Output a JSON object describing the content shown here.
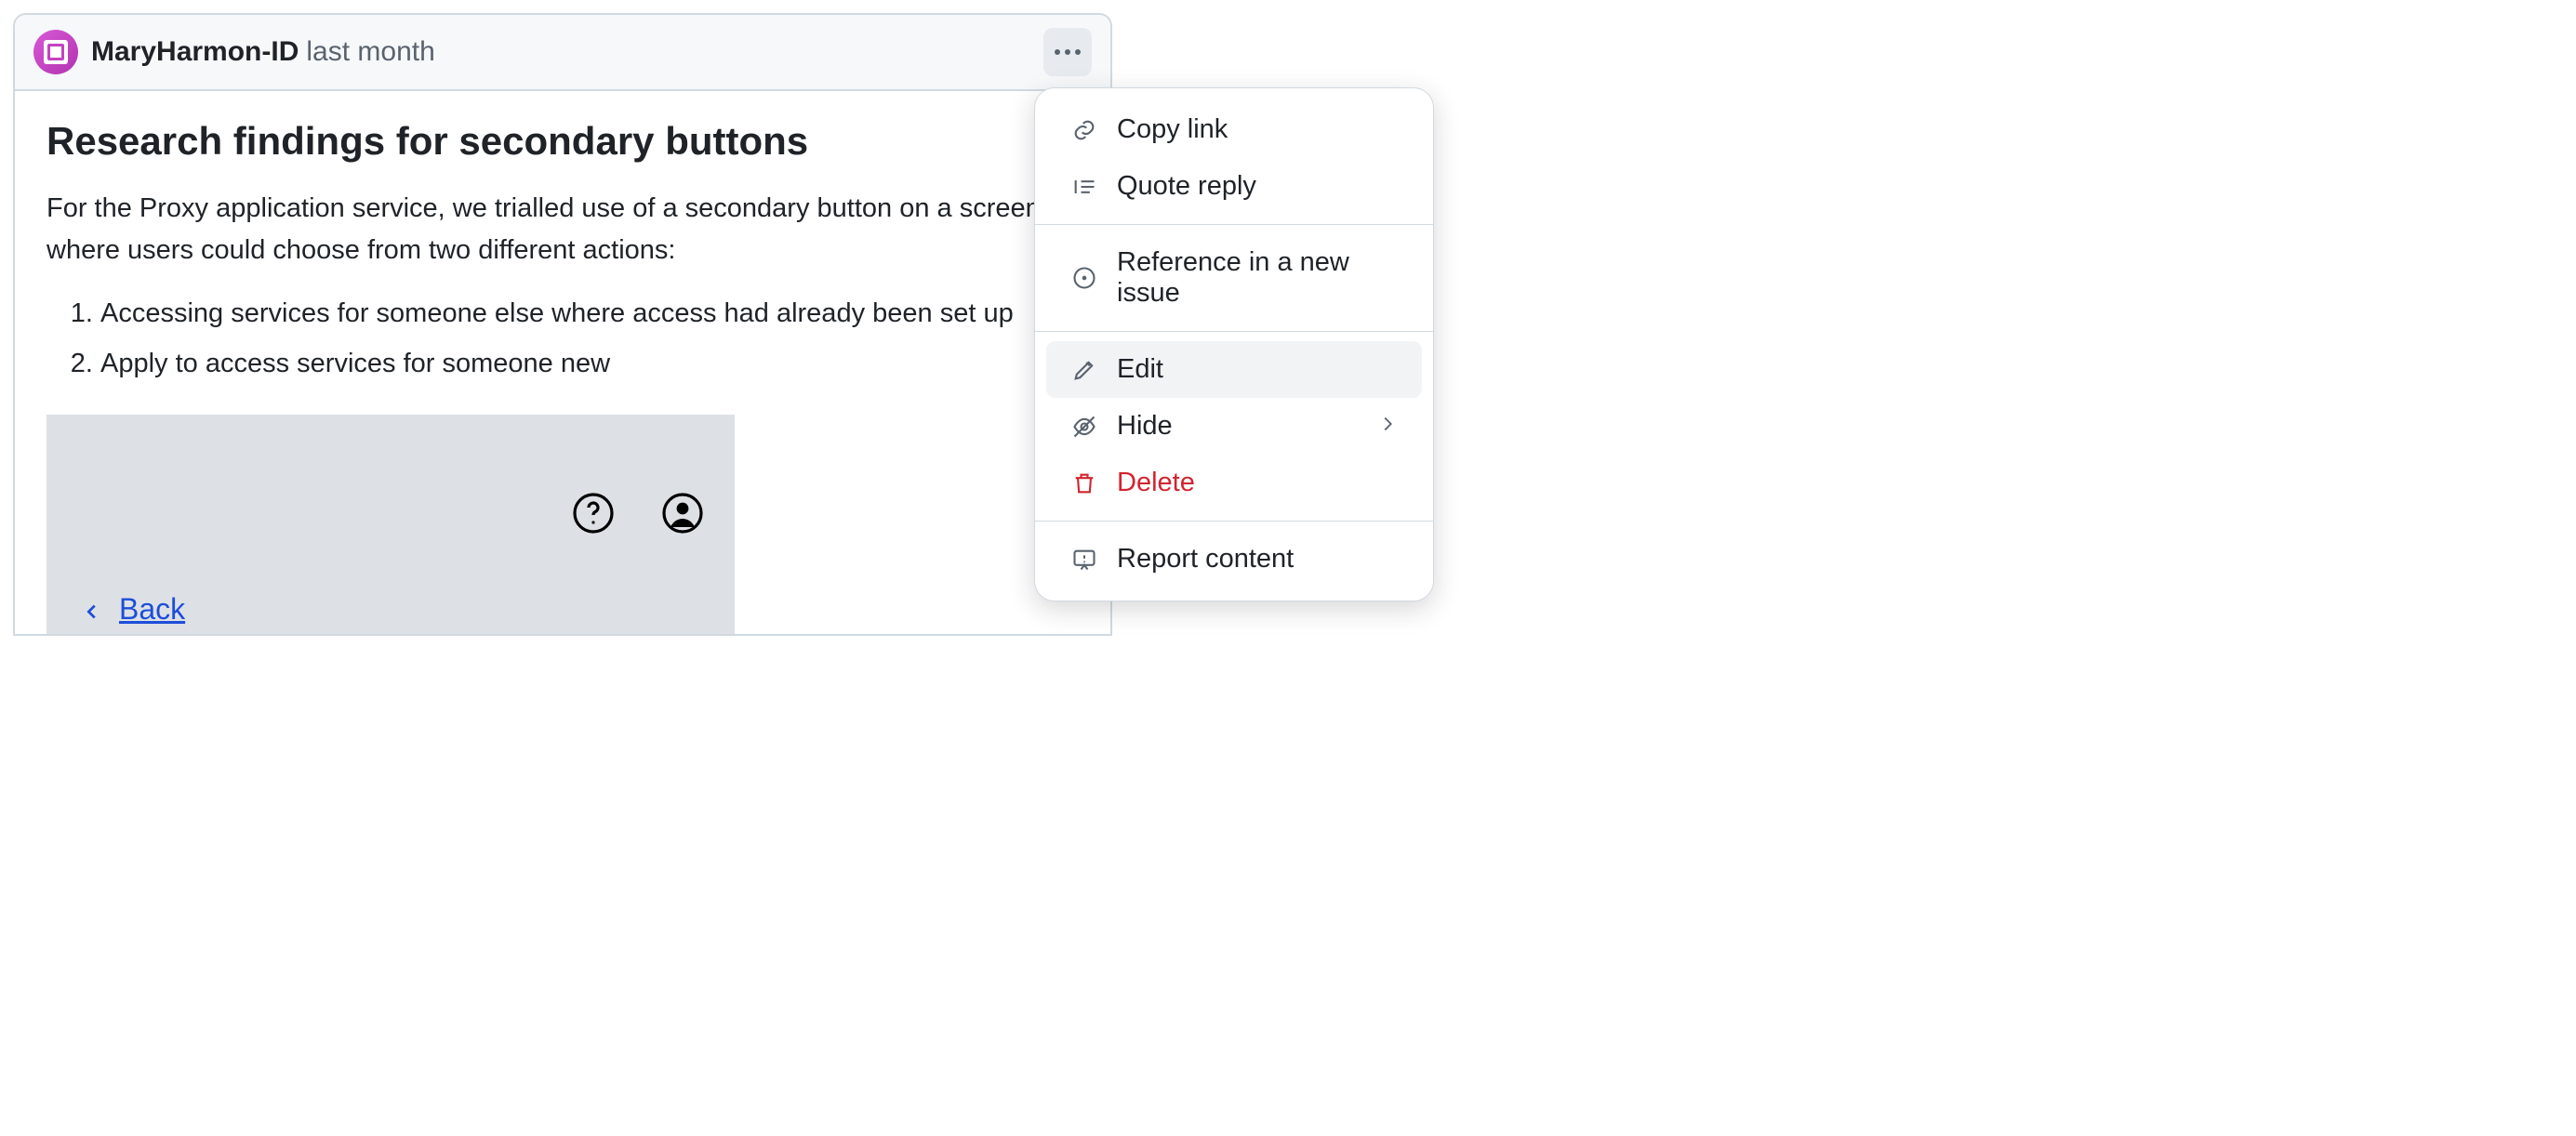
{
  "comment": {
    "author": "MaryHarmon-ID",
    "timestamp": "last month",
    "title": "Research findings for secondary buttons",
    "paragraph": "For the Proxy application service, we trialled use of a secondary button on a screen where users could choose from two different actions:",
    "list": [
      "Accessing services for someone else where access had already been set up",
      "Apply to access services for someone new"
    ],
    "embed": {
      "back_label": "Back"
    }
  },
  "menu": {
    "items": [
      {
        "icon": "link-icon",
        "label": "Copy link"
      },
      {
        "icon": "quote-icon",
        "label": "Quote reply"
      }
    ],
    "group2": [
      {
        "icon": "issue-icon",
        "label": "Reference in a new issue"
      }
    ],
    "group3": [
      {
        "icon": "pencil-icon",
        "label": "Edit",
        "hovered": true
      },
      {
        "icon": "eye-off-icon",
        "label": "Hide",
        "has_submenu": true
      },
      {
        "icon": "trash-icon",
        "label": "Delete",
        "danger": true
      }
    ],
    "group4": [
      {
        "icon": "report-icon",
        "label": "Report content"
      }
    ]
  }
}
